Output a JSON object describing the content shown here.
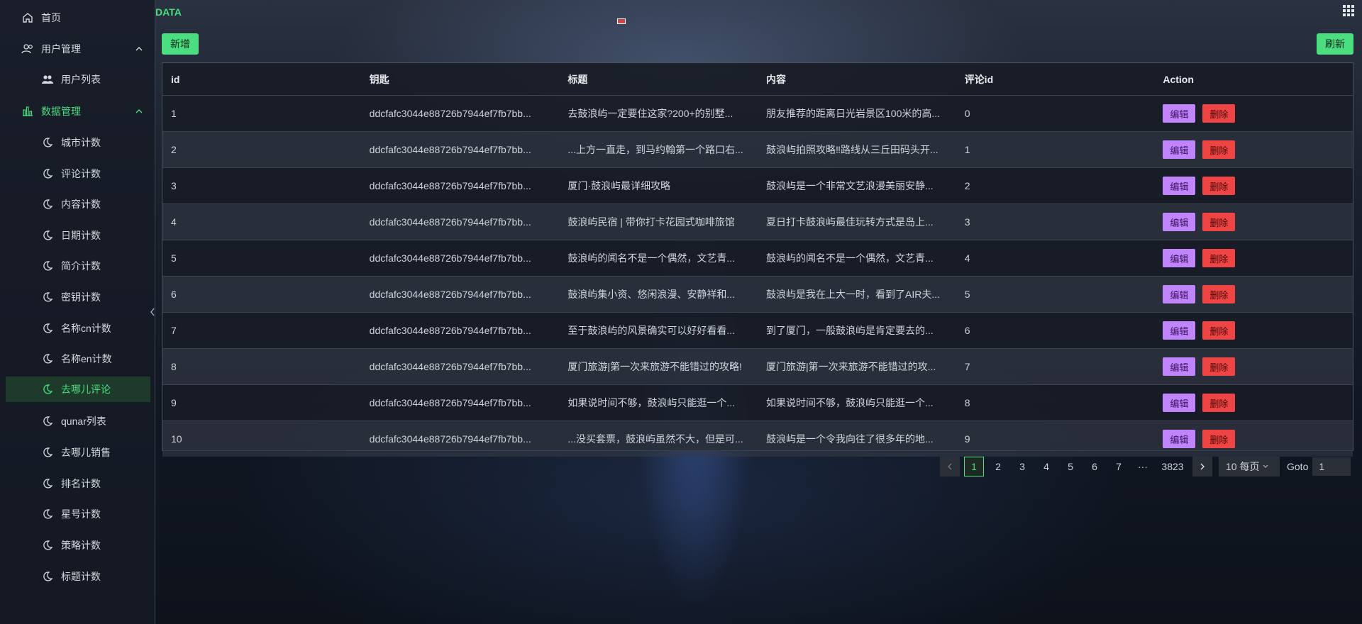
{
  "sidebar": {
    "items": [
      {
        "label": "首页",
        "icon": "home-icon"
      },
      {
        "label": "用户管理",
        "icon": "users-icon"
      },
      {
        "label": "用户列表",
        "icon": "user-group-icon"
      },
      {
        "label": "数据管理",
        "icon": "bar-chart-icon"
      },
      {
        "label": "城市计数",
        "icon": "moon-icon"
      },
      {
        "label": "评论计数",
        "icon": "moon-icon"
      },
      {
        "label": "内容计数",
        "icon": "moon-icon"
      },
      {
        "label": "日期计数",
        "icon": "moon-icon"
      },
      {
        "label": "简介计数",
        "icon": "moon-icon"
      },
      {
        "label": "密钥计数",
        "icon": "moon-icon"
      },
      {
        "label": "名称cn计数",
        "icon": "moon-icon"
      },
      {
        "label": "名称en计数",
        "icon": "moon-icon"
      },
      {
        "label": "去哪儿评论",
        "icon": "moon-icon"
      },
      {
        "label": "qunar列表",
        "icon": "moon-icon"
      },
      {
        "label": "去哪儿销售",
        "icon": "moon-icon"
      },
      {
        "label": "排名计数",
        "icon": "moon-icon"
      },
      {
        "label": "星号计数",
        "icon": "moon-icon"
      },
      {
        "label": "策略计数",
        "icon": "moon-icon"
      },
      {
        "label": "标题计数",
        "icon": "moon-icon"
      }
    ]
  },
  "header": {
    "brand": "DATA"
  },
  "toolbar": {
    "add_label": "新增",
    "refresh_label": "刷新"
  },
  "table": {
    "columns": [
      "id",
      "钥匙",
      "标题",
      "内容",
      "评论id",
      "Action"
    ],
    "rows": [
      {
        "id": "1",
        "key": "ddcfafc3044e88726b7944ef7fb7bb...",
        "title": "去鼓浪屿一定要住这家?200+的别墅...",
        "content": "朋友推荐的距离日光岩景区100米的高...",
        "comment_id": "0"
      },
      {
        "id": "2",
        "key": "ddcfafc3044e88726b7944ef7fb7bb...",
        "title": "...上方一直走，到马约翰第一个路口右...",
        "content": "鼓浪屿拍照攻略‼路线从三丘田码头开...",
        "comment_id": "1"
      },
      {
        "id": "3",
        "key": "ddcfafc3044e88726b7944ef7fb7bb...",
        "title": "厦门·鼓浪屿最详细攻略",
        "content": "鼓浪屿是一个非常文艺浪漫美丽安静...",
        "comment_id": "2"
      },
      {
        "id": "4",
        "key": "ddcfafc3044e88726b7944ef7fb7bb...",
        "title": "鼓浪屿民宿 | 带你打卡花园式咖啡旅馆",
        "content": "夏日打卡鼓浪屿最佳玩转方式是岛上...",
        "comment_id": "3"
      },
      {
        "id": "5",
        "key": "ddcfafc3044e88726b7944ef7fb7bb...",
        "title": "鼓浪屿的闻名不是一个偶然，文艺青...",
        "content": "鼓浪屿的闻名不是一个偶然，文艺青...",
        "comment_id": "4"
      },
      {
        "id": "6",
        "key": "ddcfafc3044e88726b7944ef7fb7bb...",
        "title": "鼓浪屿集小资、悠闲浪漫、安静祥和...",
        "content": "鼓浪屿是我在上大一时，看到了AIR夫...",
        "comment_id": "5"
      },
      {
        "id": "7",
        "key": "ddcfafc3044e88726b7944ef7fb7bb...",
        "title": "至于鼓浪屿的风景确实可以好好看看...",
        "content": "到了厦门，一般鼓浪屿是肯定要去的...",
        "comment_id": "6"
      },
      {
        "id": "8",
        "key": "ddcfafc3044e88726b7944ef7fb7bb...",
        "title": "厦门旅游|第一次来旅游不能错过的攻略!",
        "content": "厦门旅游|第一次来旅游不能错过的攻...",
        "comment_id": "7"
      },
      {
        "id": "9",
        "key": "ddcfafc3044e88726b7944ef7fb7bb...",
        "title": "如果说时间不够，鼓浪屿只能逛一个...",
        "content": "如果说时间不够，鼓浪屿只能逛一个...",
        "comment_id": "8"
      },
      {
        "id": "10",
        "key": "ddcfafc3044e88726b7944ef7fb7bb...",
        "title": "...没买套票，鼓浪屿虽然不大，但是可...",
        "content": "鼓浪屿是一个令我向往了很多年的地...",
        "comment_id": "9"
      }
    ],
    "edit_label": "编辑",
    "delete_label": "删除"
  },
  "pagination": {
    "pages": [
      "1",
      "2",
      "3",
      "4",
      "5",
      "6",
      "7"
    ],
    "ellipsis": "···",
    "last_page": "3823",
    "current": "1",
    "page_size": "10 每页",
    "goto_label": "Goto",
    "goto_value": "1"
  },
  "colors": {
    "accent": "#4ade80",
    "edit": "#c084fc",
    "delete": "#ef4444"
  }
}
